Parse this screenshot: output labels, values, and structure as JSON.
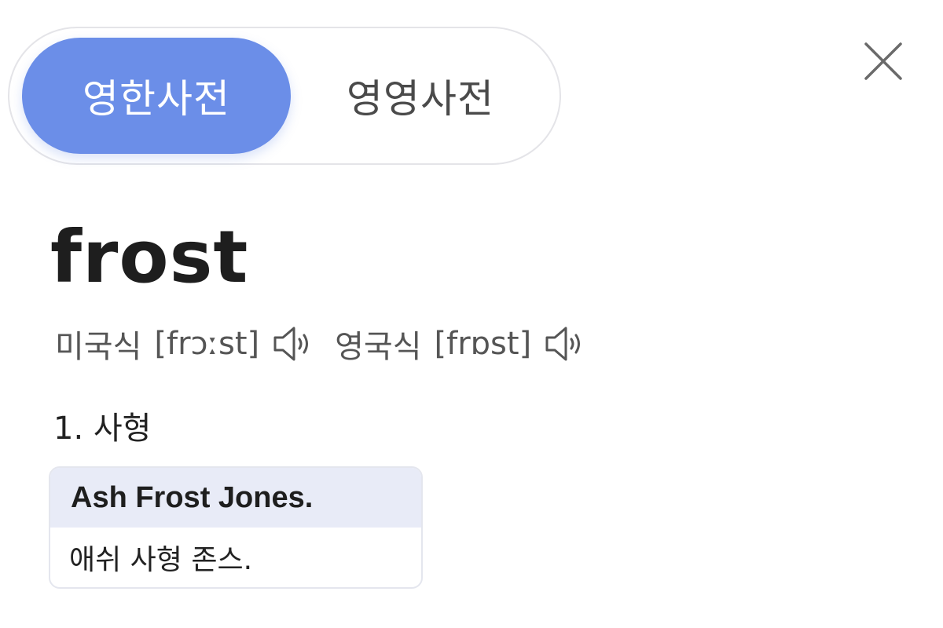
{
  "tabs": {
    "active_label": "영한사전",
    "inactive_label": "영영사전"
  },
  "close": {
    "icon": "close-icon"
  },
  "entry": {
    "headword": "frost",
    "pronunciations": [
      {
        "label": "미국식",
        "ipa": "[frɔːst]",
        "icon": "speaker-icon"
      },
      {
        "label": "영국식",
        "ipa": "[frɒst]",
        "icon": "speaker-icon"
      }
    ],
    "senses": [
      {
        "label": "1. 사형",
        "example": {
          "en": "Ash Frost Jones.",
          "ko": "애쉬 사형 존스."
        }
      }
    ]
  },
  "colors": {
    "accent": "#6b8ee8",
    "example_header_bg": "#e8ebf7"
  }
}
